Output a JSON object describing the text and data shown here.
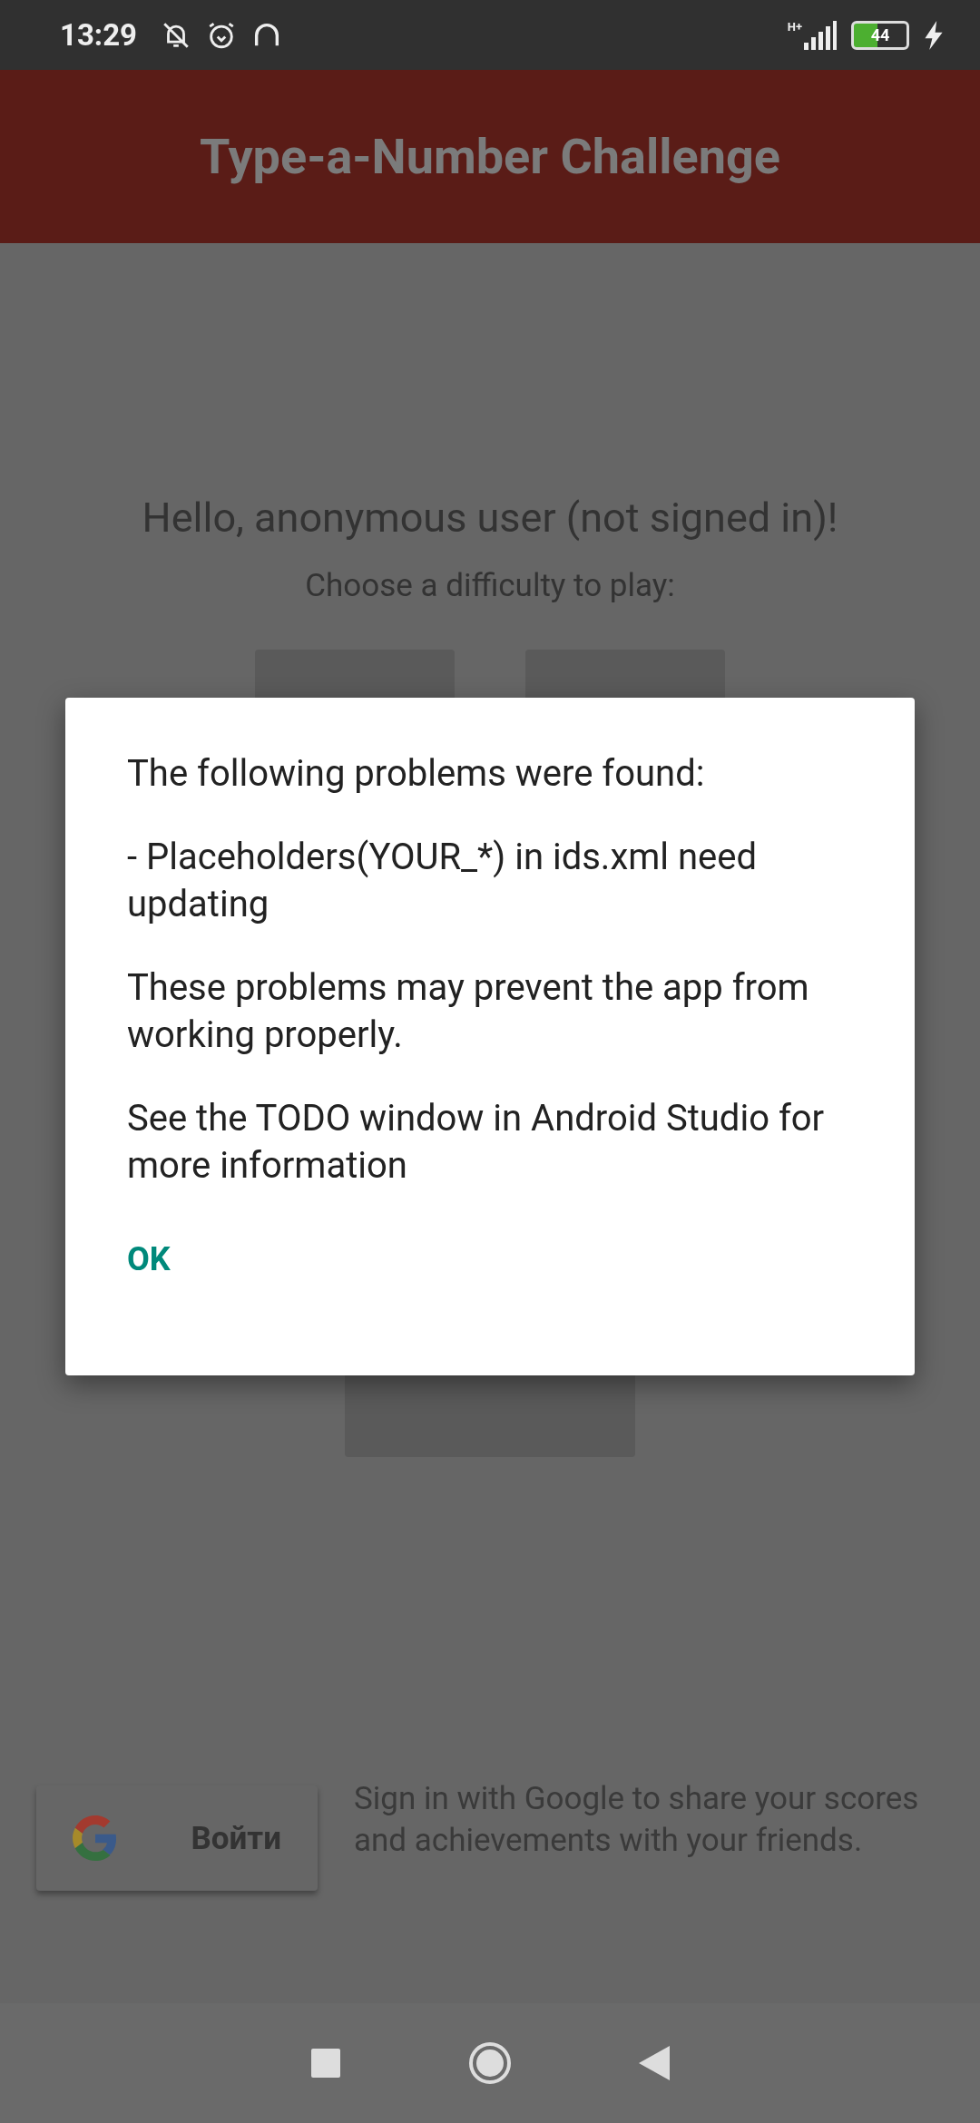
{
  "status_bar": {
    "time": "13:29",
    "network": "H+",
    "battery": "44"
  },
  "app_bar": {
    "title": "Type-a-Number Challenge"
  },
  "greeting": "Hello, anonymous user (not signed in)!",
  "prompt": "Choose a difficulty to play:",
  "dialog": {
    "paragraphs": [
      "The following problems were found:",
      "- Placeholders(YOUR_*) in ids.xml need updating",
      "These problems may prevent the app from working properly.",
      "See the TODO window in Android Studio for more information"
    ],
    "button": "OK"
  },
  "sign_in": {
    "button": "Войти",
    "text": "Sign in with Google to share your scores and achievements with your friends."
  }
}
